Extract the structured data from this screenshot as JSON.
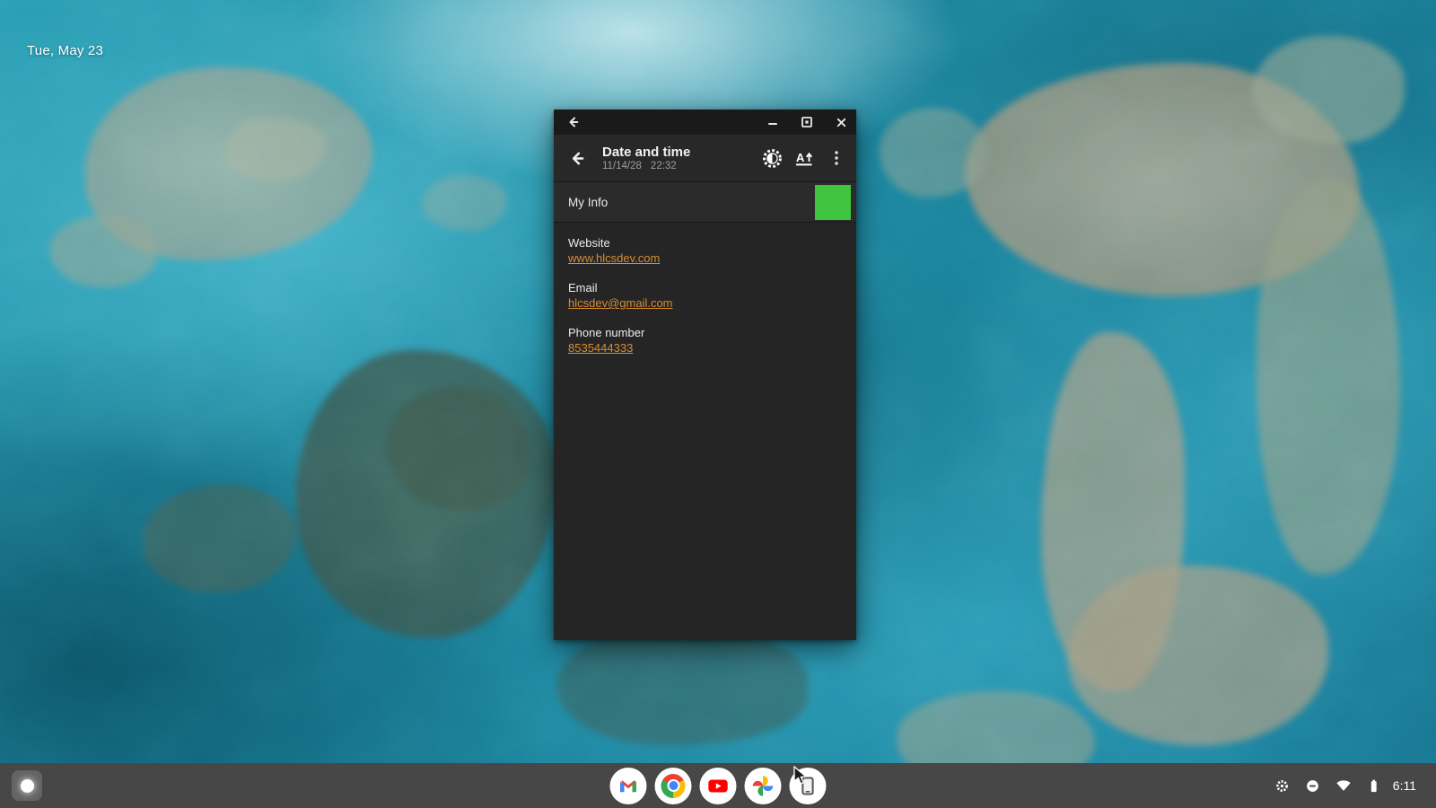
{
  "desktop": {
    "date_label": "Tue, May 23",
    "wallpaper_theme": "aerial-coral-reef-teal"
  },
  "app_window": {
    "titlebar": {
      "back_icon": "back-arrow-icon",
      "minimize_icon": "minimize-icon",
      "maximize_icon": "maximize-icon",
      "close_icon": "close-icon"
    },
    "header": {
      "back_icon": "back-arrow-icon",
      "title": "Date and time",
      "date": "11/14/28",
      "time": "22:32",
      "action_icons": [
        "display-contrast-icon",
        "font-size-icon",
        "overflow-menu-icon"
      ]
    },
    "my_info": {
      "label": "My Info",
      "swatch_color": "#3ec43e"
    },
    "link_color": "#d98c33",
    "fields": [
      {
        "label": "Website",
        "value": "www.hlcsdev.com"
      },
      {
        "label": "Email",
        "value": "hlcsdev@gmail.com"
      },
      {
        "label": "Phone number",
        "value": "8535444333"
      }
    ]
  },
  "shelf": {
    "launcher_icon": "app-launcher-icon",
    "apps": [
      "gmail",
      "chrome",
      "youtube",
      "google-photos",
      "device-frame-app"
    ],
    "active_app": "device-frame-app",
    "tray": {
      "icons": [
        "gear-icon",
        "do-not-disturb-icon",
        "wifi-icon",
        "battery-icon"
      ],
      "time": "6:11"
    }
  }
}
